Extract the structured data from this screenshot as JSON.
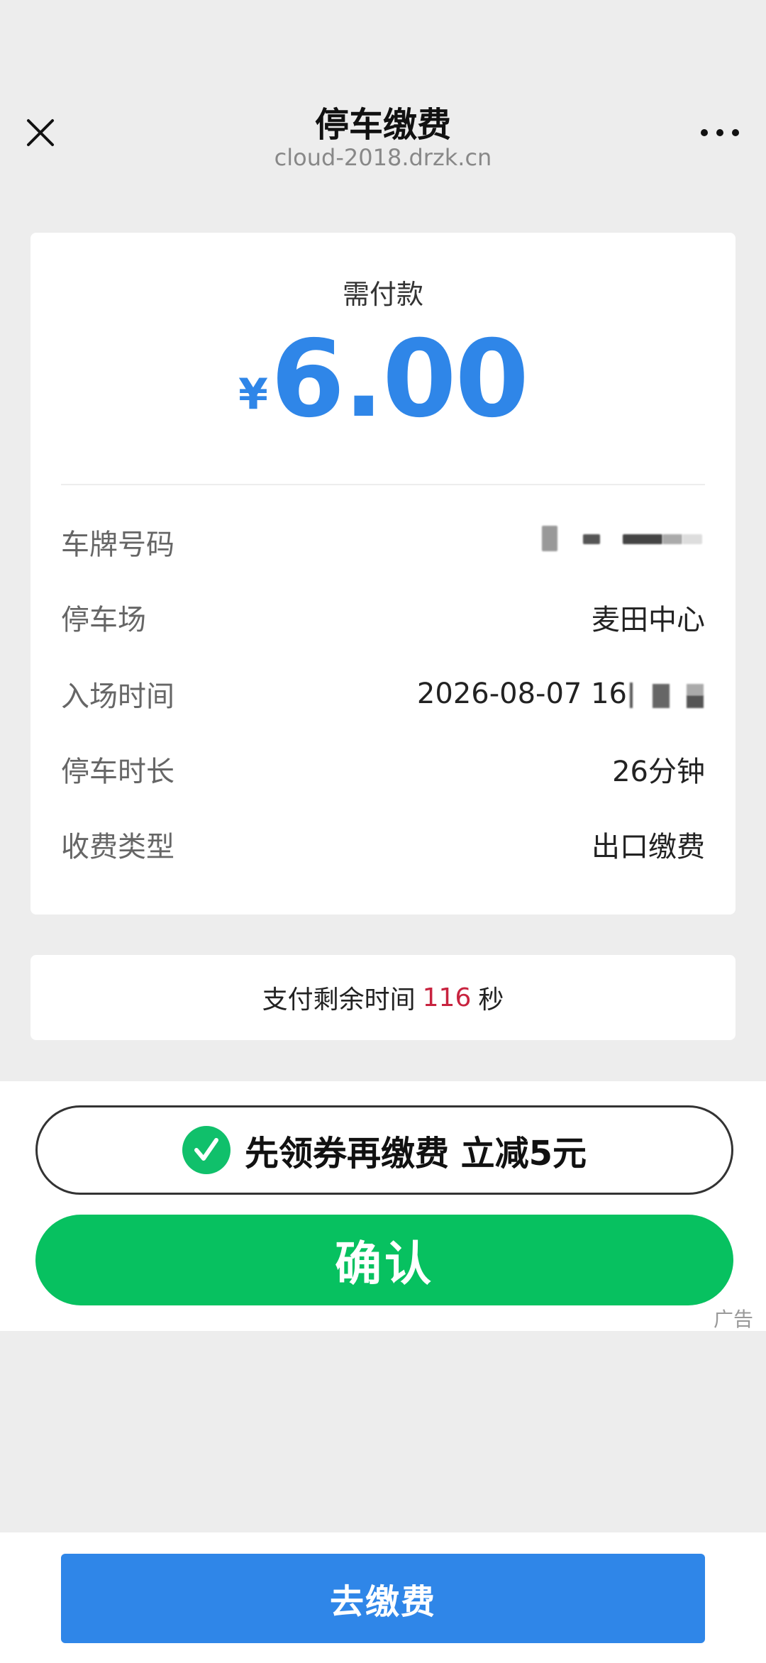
{
  "header": {
    "title": "停车缴费",
    "domain": "cloud-2018.drzk.cn"
  },
  "card": {
    "amount_label": "需付款",
    "currency": "¥",
    "amount": "6.00",
    "rows": [
      {
        "key": "车牌号码",
        "value": ""
      },
      {
        "key": "停车场",
        "value": "麦田中心"
      },
      {
        "key": "入场时间",
        "value": "2026-08-07 16"
      },
      {
        "key": "停车时长",
        "value": "26分钟"
      },
      {
        "key": "收费类型",
        "value": "出口缴费"
      }
    ]
  },
  "countdown": {
    "prefix": "支付剩余时间",
    "seconds": "116",
    "suffix": "秒"
  },
  "ad": {
    "coupon_label": "先领券再缴费 立减5元",
    "confirm_label": "确认",
    "tag": "广告"
  },
  "bottom": {
    "pay_label": "去缴费"
  },
  "colors": {
    "accent_blue": "#2f86e8",
    "green": "#07c160",
    "countdown_red": "#c8233f"
  },
  "icons": {
    "close": "close-icon",
    "more": "more-dots-icon",
    "check": "check-icon"
  }
}
